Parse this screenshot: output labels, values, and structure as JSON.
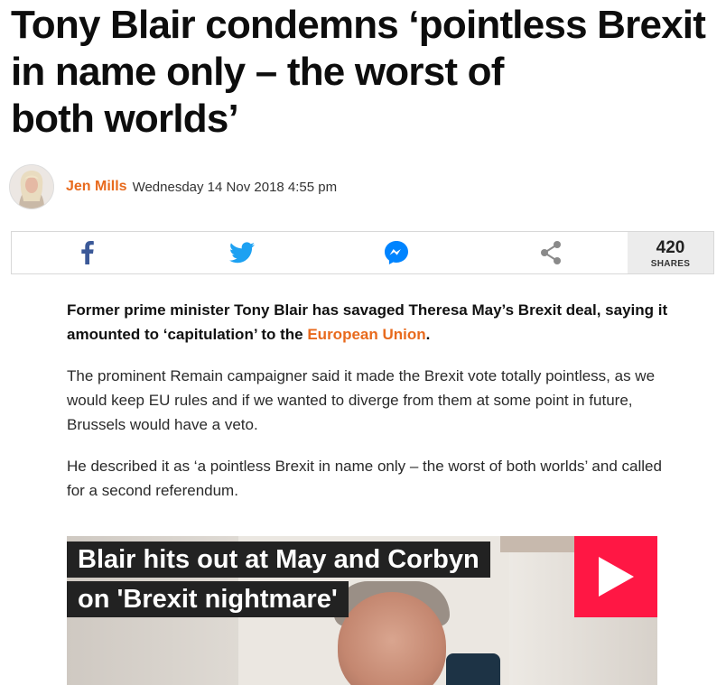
{
  "article": {
    "headline_lines": [
      "Tony Blair condemns ‘pointless Brexit",
      "in name only – the worst of",
      "both worlds’"
    ],
    "author": "Jen Mills",
    "date": "Wednesday 14 Nov 2018 4:55 pm",
    "lead": {
      "text_before": "Former prime minister Tony Blair has savaged Theresa May’s Brexit deal, saying it amounted to ‘capitulation’ to the ",
      "link": "European Union",
      "text_after": "."
    },
    "paragraphs": [
      "The prominent Remain campaigner said it made the Brexit vote totally pointless, as we would keep EU rules and if we wanted to diverge from them at some point in future, Brussels would have a veto.",
      "He described it as ‘a pointless Brexit in name only – the worst of both worlds’ and called for a second referendum."
    ]
  },
  "share": {
    "icons": [
      "facebook-icon",
      "twitter-icon",
      "messenger-icon",
      "share-icon"
    ],
    "count": "420",
    "count_label": "SHARES"
  },
  "video": {
    "caption_lines": [
      "Blair hits out at May and Corbyn",
      "on 'Brexit nightmare'"
    ],
    "play_icon": "play-icon"
  },
  "colors": {
    "accent": "#e86a1d",
    "facebook": "#3b5998",
    "twitter": "#1da1f2",
    "messenger": "#0084ff",
    "play": "#ff1744",
    "caption_bg": "#222222"
  }
}
